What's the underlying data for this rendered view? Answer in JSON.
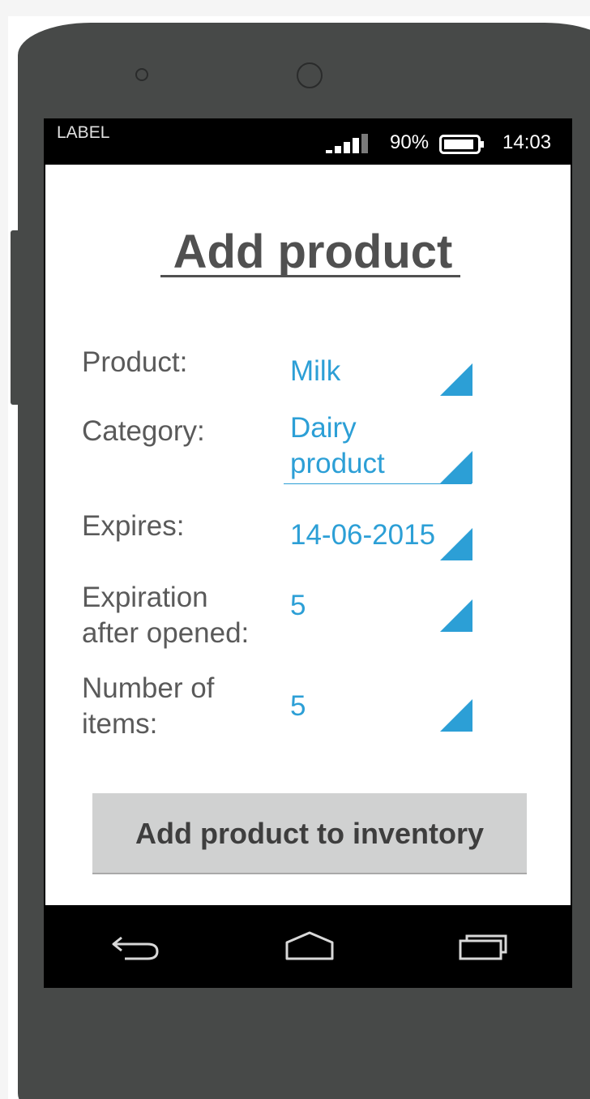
{
  "status_bar": {
    "label": "LABEL",
    "battery_percent": "90%",
    "battery_level": 0.9,
    "time": "14:03"
  },
  "header": {
    "title": "Add product"
  },
  "form": {
    "fields": [
      {
        "label": "Product:",
        "value": "Milk"
      },
      {
        "label": "Category:",
        "value": "Dairy\nproduct"
      },
      {
        "label": "Expires:",
        "value": "14-06-2015"
      },
      {
        "label": "Expiration\nafter opened:",
        "value": "5"
      },
      {
        "label": "Number of\nitems:",
        "value": "5"
      }
    ]
  },
  "actions": {
    "add_label": "Add product to inventory"
  },
  "icons": {
    "signal": "signal-strength-icon",
    "battery": "battery-icon",
    "dropdown": "dropdown-triangle-icon",
    "back": "back-arrow-icon",
    "home": "home-icon",
    "recents": "recent-apps-icon"
  },
  "colors": {
    "value_blue": "#2c9fd6",
    "phone_body": "#474948",
    "button_bg": "#d0d1d1"
  }
}
